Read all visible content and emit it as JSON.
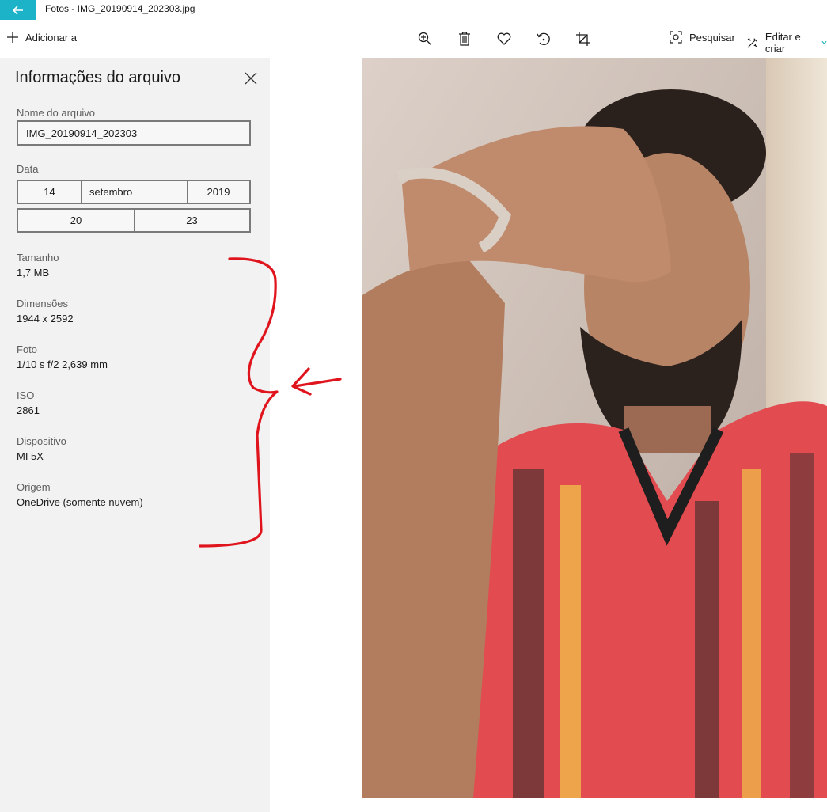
{
  "window": {
    "title": "Fotos - IMG_20190914_202303.jpg",
    "accent_color": "#1cb3c8"
  },
  "toolbar": {
    "add_label": "Adicionar a",
    "search_label": "Pesquisar",
    "edit_label": "Editar e criar",
    "icons": [
      "zoom-in-icon",
      "delete-icon",
      "favorite-icon",
      "rotate-icon",
      "crop-icon"
    ]
  },
  "panel": {
    "title": "Informações do arquivo",
    "filename_label": "Nome do arquivo",
    "filename_value": "IMG_20190914_202303",
    "date_label": "Data",
    "date_day": "14",
    "date_month": "setembro",
    "date_year": "2019",
    "time_hour": "20",
    "time_minute": "23",
    "size_label": "Tamanho",
    "size_value": "1,7 MB",
    "dimensions_label": "Dimensões",
    "dimensions_value": "1944 x 2592",
    "photo_label": "Foto",
    "photo_value": "1/10 s f/2 2,639 mm",
    "iso_label": "ISO",
    "iso_value": "2861",
    "device_label": "Dispositivo",
    "device_value": "MI 5X",
    "origin_label": "Origem",
    "origin_value": "OneDrive (somente nuvem)"
  },
  "annotation": {
    "color": "#e0141c"
  }
}
